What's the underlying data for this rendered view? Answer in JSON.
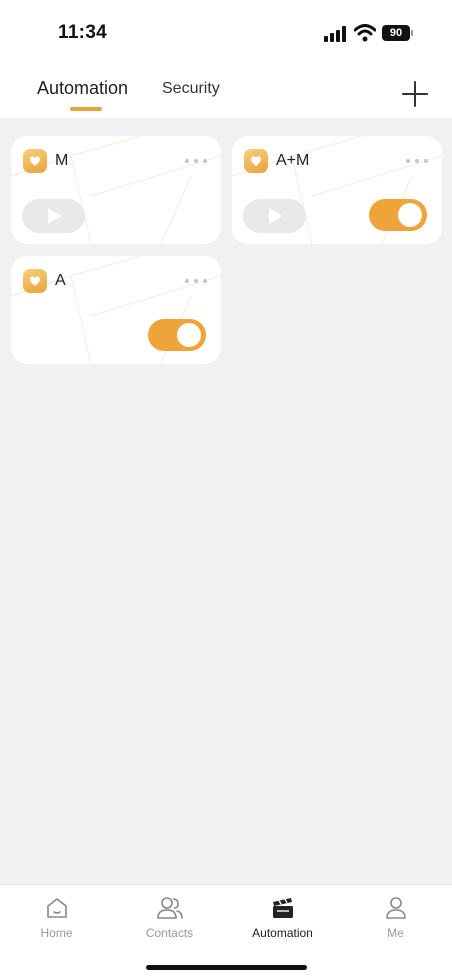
{
  "status_bar": {
    "time": "11:34",
    "battery": "90"
  },
  "tabs": [
    {
      "label": "Automation",
      "active": true
    },
    {
      "label": "Security",
      "active": false
    }
  ],
  "cards": [
    {
      "title": "M",
      "has_play": true,
      "toggle": null
    },
    {
      "title": "A+M",
      "has_play": true,
      "toggle": true
    },
    {
      "title": "A",
      "has_play": false,
      "toggle": true
    }
  ],
  "bottom_nav": {
    "items": [
      {
        "label": "Home",
        "icon": "home-icon"
      },
      {
        "label": "Contacts",
        "icon": "contacts-icon"
      },
      {
        "label": "Automation",
        "icon": "clapperboard-icon",
        "active": true
      },
      {
        "label": "Me",
        "icon": "person-icon"
      }
    ]
  },
  "colors": {
    "accent": "#eea43a",
    "background": "#f0f1f3",
    "card": "#ffffff"
  }
}
